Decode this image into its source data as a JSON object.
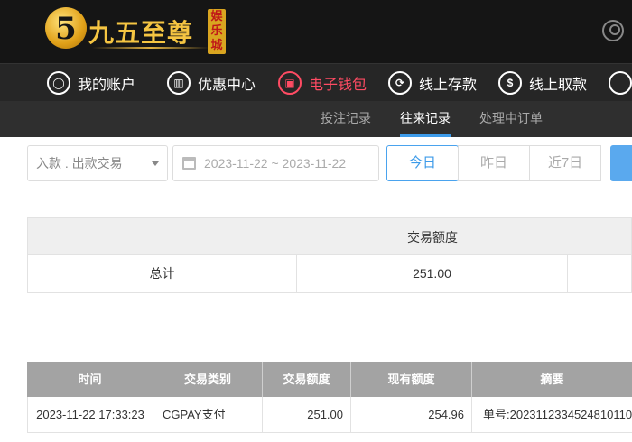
{
  "header": {
    "logo_glyph": "5",
    "logo_name": "九五至尊",
    "logo_badge": "娱乐城",
    "user_icon": "user-circle-icon"
  },
  "nav": {
    "items": [
      {
        "label": "我的账户",
        "icon": "user-icon",
        "glyph": "◯"
      },
      {
        "label": "优惠中心",
        "icon": "gift-icon",
        "glyph": "▥"
      },
      {
        "label": "电子钱包",
        "icon": "wallet-icon",
        "glyph": "▣"
      },
      {
        "label": "线上存款",
        "icon": "deposit-icon",
        "glyph": "⟳"
      },
      {
        "label": "线上取款",
        "icon": "withdraw-icon",
        "glyph": "$"
      }
    ],
    "active_color": "#ff4b63"
  },
  "subnav": {
    "tabs": [
      {
        "label": "投注记录"
      },
      {
        "label": "往来记录"
      },
      {
        "label": "处理中订单"
      }
    ],
    "active_tab": "往来记录",
    "accent": "#3d9be9"
  },
  "filters": {
    "type_select": "入款 . 出款交易",
    "date_range": "2023-11-22 ~ 2023-11-22",
    "quick_buttons": [
      {
        "label": "今日"
      },
      {
        "label": "昨日"
      },
      {
        "label": "近7日"
      }
    ],
    "active_quick": "今日"
  },
  "summary": {
    "header": "交易额度",
    "total_label": "总计",
    "total_value": "251.00"
  },
  "detail": {
    "columns": [
      "时间",
      "交易类别",
      "交易额度",
      "现有额度",
      "摘要"
    ],
    "rows": [
      {
        "time": "2023-11-22 17:33:23",
        "type": "CGPAY支付",
        "amount": "251.00",
        "balance": "254.96",
        "summary": "单号:2023112334524810110"
      }
    ]
  }
}
